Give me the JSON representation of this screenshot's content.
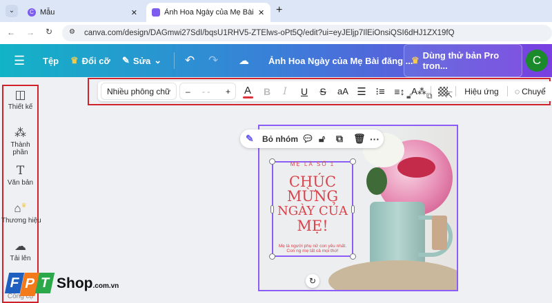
{
  "browser": {
    "tabs": [
      {
        "label": "Mẫu"
      },
      {
        "label": "Ảnh Hoa Ngày của Mẹ Bài đăng"
      }
    ],
    "url": "canva.com/design/DAGmwi27SdI/bqsU1RHV5-ZTElws-oPt5Q/edit?ui=eyJEljp7IlEiOnsiQSI6dHJ1ZX19fQ"
  },
  "header": {
    "file": "Tệp",
    "resize": "Đổi cỡ",
    "edit": "Sửa",
    "title": "Ảnh Hoa Ngày của Mẹ Bài đăng ...",
    "pro": "Dùng thử bản Pro tron...",
    "avatar": "C"
  },
  "sidebar": {
    "items": [
      {
        "label": "Thiết kế"
      },
      {
        "label": "Thành phần"
      },
      {
        "label": "Văn bản"
      },
      {
        "label": "Thương hiệu"
      },
      {
        "label": "Tải lên"
      },
      {
        "label": "Công cụ"
      }
    ]
  },
  "toolbar": {
    "font": "Nhiều phông chữ",
    "minus": "–",
    "size": "- -",
    "plus": "+",
    "color_letter": "A",
    "bold": "B",
    "italic": "I",
    "underline": "U",
    "strike": "S",
    "case": "aA",
    "effects": "Hiệu ứng",
    "animate": "Chuyể",
    "text_color": "#e0303a"
  },
  "float_menu": {
    "ungroup": "Bỏ nhóm"
  },
  "design": {
    "eyebrow": "MẸ LÀ SỐ 1",
    "headline": [
      "CHÚC",
      "MỪNG",
      "NGÀY CỦA",
      "MẸ!"
    ],
    "body": [
      "Mẹ là người phụ nữ con yêu nhất.",
      "Con ng mẹ tất cả mọi thứ!"
    ]
  },
  "watermark": {
    "brand": "FPT",
    "shop": "Shop",
    ".com.vn": ".com.vn"
  }
}
